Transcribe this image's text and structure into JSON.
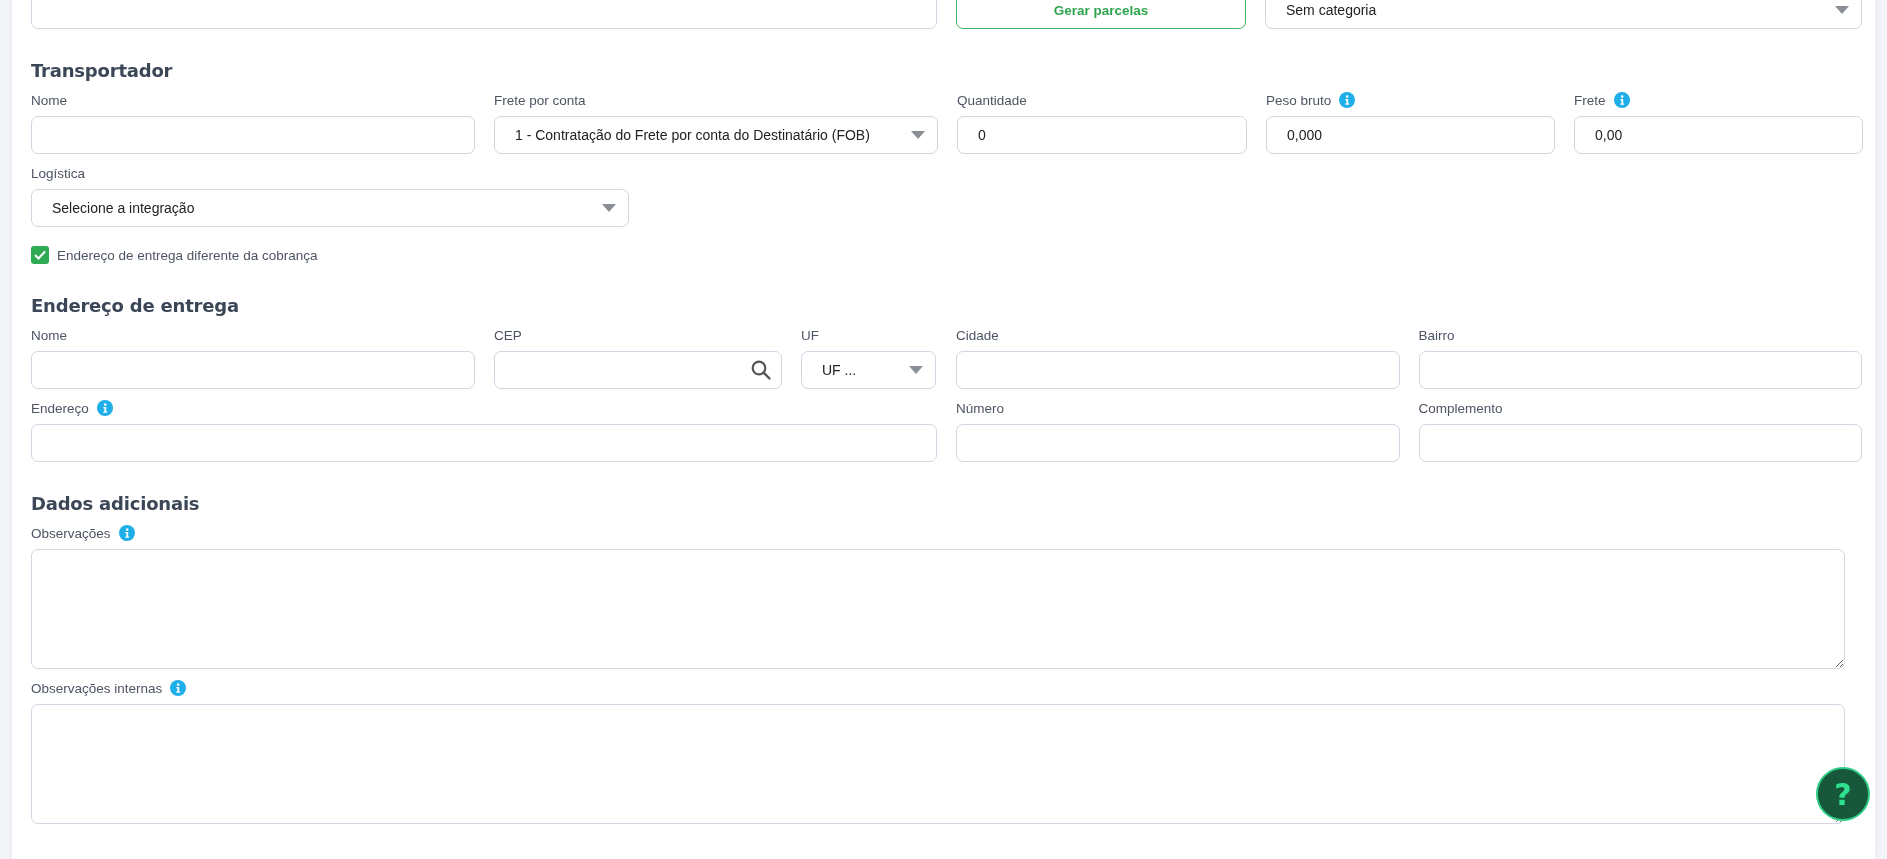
{
  "top_fields": [
    {
      "kind": "input"
    },
    {
      "kind": "button",
      "label": "Gerar parcelas"
    },
    {
      "kind": "select",
      "value": "Sem categoria"
    }
  ],
  "sections": [
    {
      "title": "Transportador",
      "rows": [
        [
          {
            "kind": "input",
            "label": "Nome"
          },
          {
            "kind": "select",
            "label": "Frete por conta",
            "value": "1 - Contratação do Frete por conta do Destinatário (FOB)"
          },
          {
            "kind": "input",
            "label": "Quantidade",
            "value": "0"
          },
          {
            "kind": "input",
            "label": "Peso bruto",
            "value": "0,000",
            "info": true
          },
          {
            "kind": "input",
            "label": "Frete",
            "value": "0,00",
            "info": true
          }
        ],
        [
          {
            "kind": "select",
            "label": "Logística",
            "value": "Selecione a integração"
          }
        ]
      ],
      "checkbox": {
        "label": "Endereço de entrega diferente da cobrança",
        "checked": true
      }
    },
    {
      "title": "Endereço de entrega",
      "groups": [
        {
          "rows": [
            [
              {
                "kind": "input",
                "label": "Nome"
              },
              {
                "kind": "search",
                "label": "CEP"
              },
              {
                "kind": "select",
                "label": "UF",
                "value": "UF ..."
              }
            ],
            [
              {
                "kind": "input",
                "label": "Endereço",
                "info": true
              }
            ]
          ]
        },
        {
          "rows": [
            [
              {
                "kind": "input",
                "label": "Cidade"
              },
              {
                "kind": "input",
                "label": "Bairro"
              }
            ],
            [
              {
                "kind": "input",
                "label": "Número"
              },
              {
                "kind": "input",
                "label": "Complemento"
              }
            ]
          ]
        }
      ]
    },
    {
      "title": "Dados adicionais",
      "rows": [
        [
          {
            "kind": "textarea",
            "label": "Observações",
            "info": true
          }
        ],
        [
          {
            "kind": "textarea",
            "label": "Observações internas",
            "info": true
          }
        ]
      ]
    }
  ],
  "help_button": {
    "label": "?"
  }
}
